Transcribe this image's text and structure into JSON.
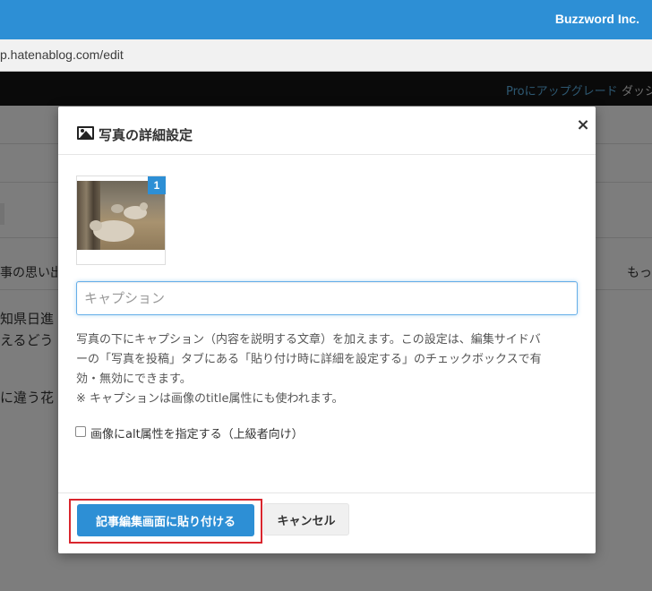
{
  "browser": {
    "url": "p.hatenablog.com/edit",
    "brand": "Buzzword Inc."
  },
  "background_page": {
    "nav_pro": "Proにアップグレード",
    "nav_dashboard": "ダッシ",
    "text_memory": "事の思い出",
    "text_right": "もっ",
    "text_line1": "知県日進",
    "text_line2": "えるどう",
    "text_line3": "に違う花"
  },
  "modal": {
    "title": "写真の詳細設定",
    "close_symbol": "×",
    "thumbnail_badge": "1",
    "caption_placeholder": "キャプション",
    "caption_value": "",
    "help_lines": [
      "写真の下にキャプション（内容を説明する文章）を加えます。この設定は、編集サイドバ",
      "ーの「写真を投稿」タブにある「貼り付け時に詳細を設定する」のチェックボックスで有",
      "効・無効にできます。",
      "※ キャプションは画像のtitle属性にも使われます。"
    ],
    "alt_checkbox_label": "画像にalt属性を指定する（上級者向け）",
    "alt_checked": false,
    "primary_button": "記事編集画面に貼り付ける",
    "cancel_button": "キャンセル"
  },
  "colors": {
    "brand_blue": "#2d8fd5",
    "highlight_red": "#d9262e",
    "overlay": "rgba(0,0,0,0.5)"
  }
}
